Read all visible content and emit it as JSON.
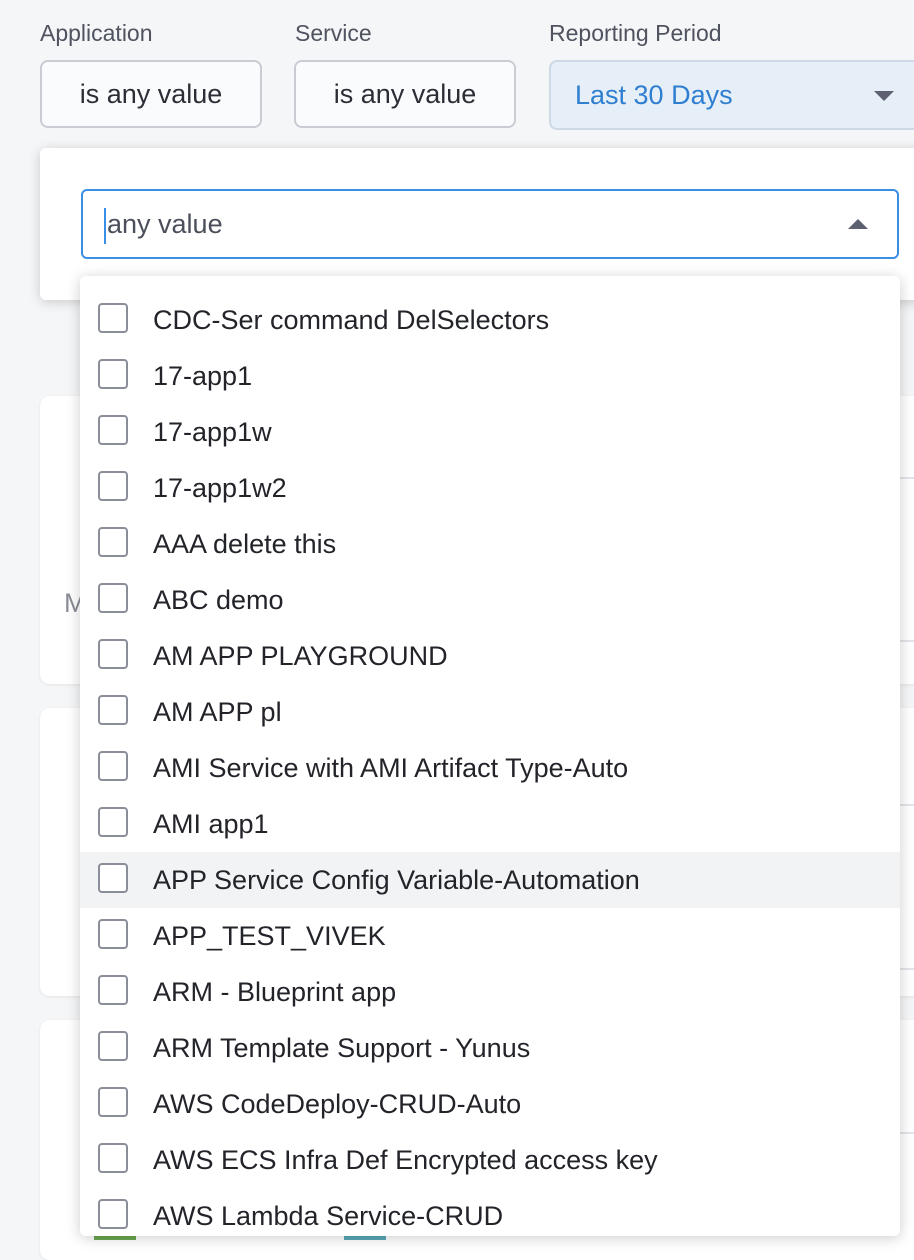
{
  "filters": {
    "application": {
      "label": "Application",
      "value": "is any value"
    },
    "service": {
      "label": "Service",
      "value": "is any value"
    },
    "reporting_period": {
      "label": "Reporting Period",
      "value": "Last 30 Days"
    }
  },
  "dropdown": {
    "search_placeholder": "any value",
    "options": [
      "CDC-Ser command DelSelectors",
      "17-app1",
      "17-app1w",
      "17-app1w2",
      "AAA delete this",
      "ABC demo",
      "AM APP PLAYGROUND",
      "AM APP pl",
      "AMI Service with AMI Artifact Type-Auto",
      "AMI app1",
      "APP Service Config Variable-Automation",
      "APP_TEST_VIVEK",
      "ARM - Blueprint app",
      "ARM Template Support - Yunus",
      "AWS CodeDeploy-CRUD-Auto",
      "AWS ECS Infra Def Encrypted access key",
      "AWS Lambda Service-CRUD"
    ],
    "hovered_index": 10
  },
  "background": {
    "partial_letter": "M"
  },
  "colors": {
    "accent": "#3a8ee6",
    "period_bg": "#e6eef8",
    "period_text": "#2f7fd0"
  },
  "icons": {
    "period_caret": "caret-down-icon",
    "search_caret": "caret-up-icon",
    "option_checkbox": "checkbox-unchecked-icon"
  }
}
